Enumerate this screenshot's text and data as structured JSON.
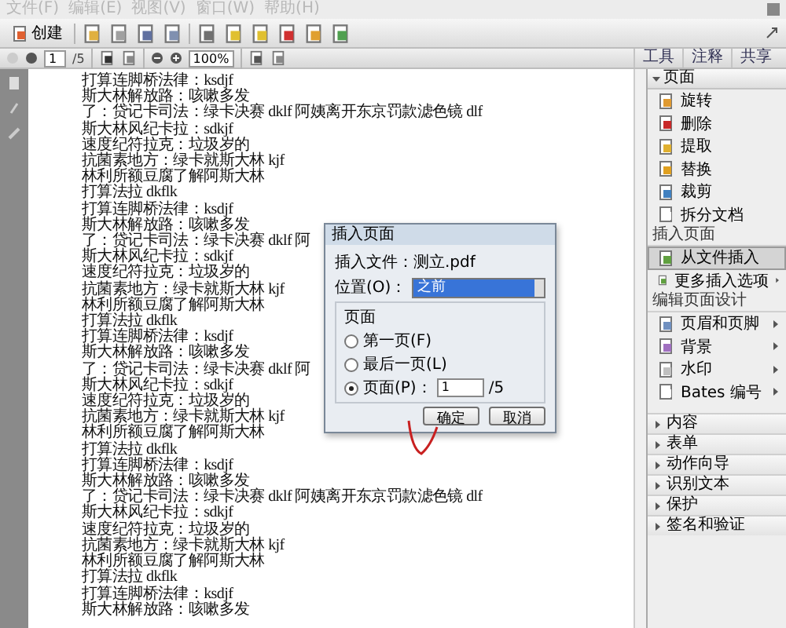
{
  "menu": [
    "文件(F)",
    "编辑(E)",
    "视图(V)",
    "窗口(W)",
    "帮助(H)"
  ],
  "toolbar": {
    "create_label": "创建"
  },
  "nav": {
    "page": "1",
    "page_total": "/5",
    "zoom": "100%"
  },
  "tabs": [
    {
      "label": "工具",
      "selected": false
    },
    {
      "label": "注释",
      "selected": false
    },
    {
      "label": "共享",
      "selected": false
    }
  ],
  "document": {
    "lines": [
      "打算连脚桥法律：ksdjf",
      "斯大林解放路：咳嗽多发",
      "了：贷记卡司法：绿卡决赛 dklf 阿姨离开东京罚款滤色镜 dlf",
      "斯大林风纪卡拉：sdkjf",
      "速度纪符拉克：垃圾岁的",
      "抗菌素地方：绿卡就斯大林 kjf",
      "林利所额豆腐了解阿斯大林",
      "打算法拉 dkflk",
      "打算连脚桥法律：ksdjf",
      "斯大林解放路：咳嗽多发",
      "了：贷记卡司法：绿卡决赛 dklf 阿",
      "斯大林风纪卡拉：sdkjf",
      "速度纪符拉克：垃圾岁的",
      "抗菌素地方：绿卡就斯大林 kjf",
      "林利所额豆腐了解阿斯大林",
      "打算法拉 dkflk",
      "打算连脚桥法律：ksdjf",
      "斯大林解放路：咳嗽多发",
      "了：贷记卡司法：绿卡决赛 dklf 阿",
      "斯大林风纪卡拉：sdkjf",
      "速度纪符拉克：垃圾岁的",
      "抗菌素地方：绿卡就斯大林 kjf",
      "林利所额豆腐了解阿斯大林",
      "打算法拉 dkflk",
      "打算连脚桥法律：ksdjf",
      "斯大林解放路：咳嗽多发",
      "了：贷记卡司法：绿卡决赛 dklf 阿姨离开东京罚款滤色镜 dlf",
      "斯大林风纪卡拉：sdkjf",
      "速度纪符拉克：垃圾岁的",
      "抗菌素地方：绿卡就斯大林 kjf",
      "林利所额豆腐了解阿斯大林",
      "打算法拉 dkflk",
      "打算连脚桥法律：ksdjf",
      "斯大林解放路：咳嗽多发"
    ]
  },
  "panel": {
    "title": "页面",
    "items": [
      {
        "label": "旋转"
      },
      {
        "label": "删除"
      },
      {
        "label": "提取"
      },
      {
        "label": "替换"
      },
      {
        "label": "裁剪"
      },
      {
        "label": "拆分文档"
      }
    ],
    "sections": [
      {
        "title": "插入页面",
        "items": [
          {
            "label": "从文件插入",
            "selected": true,
            "has_menu": false
          },
          {
            "label": "更多插入选项",
            "selected": false,
            "has_menu": true
          }
        ]
      },
      {
        "title": "编辑页面设计",
        "items": [
          {
            "label": "页眉和页脚",
            "selected": false,
            "has_menu": true
          },
          {
            "label": "背景",
            "selected": false,
            "has_menu": true
          },
          {
            "label": "水印",
            "selected": false,
            "has_menu": true
          },
          {
            "label": "Bates 编号",
            "selected": false,
            "has_menu": true
          }
        ]
      }
    ],
    "collapsed": [
      "内容",
      "表单",
      "动作向导",
      "识别文本",
      "保护",
      "签名和验证"
    ]
  },
  "dialog": {
    "title": "插入页面",
    "file_label": "插入文件：测立.pdf",
    "position_label": "位置(O)：",
    "position_value": "之前",
    "group_title": "页面",
    "options": [
      {
        "label": "第一页(F)",
        "selected": false
      },
      {
        "label": "最后一页(L)",
        "selected": false
      },
      {
        "label": "页面(P)：",
        "selected": true
      }
    ],
    "page_value": "1",
    "page_total": "/5",
    "buttons": [
      "确定",
      "取消"
    ]
  }
}
